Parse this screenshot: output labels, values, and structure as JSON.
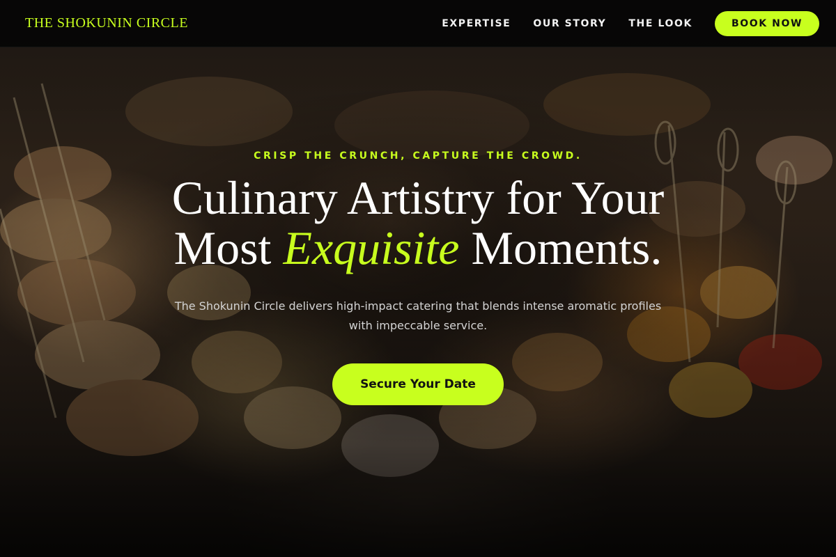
{
  "colors": {
    "accent": "#c8ff1e",
    "nav_background": "#050505",
    "heading_text": "#ffffff",
    "body_text": "#d4d4d4"
  },
  "nav": {
    "brand": "THE SHOKUNIN CIRCLE",
    "links": [
      {
        "label": "EXPERTISE"
      },
      {
        "label": "OUR STORY"
      },
      {
        "label": "THE LOOK"
      }
    ],
    "cta_label": "BOOK NOW"
  },
  "hero": {
    "background_image": "catering-canapes-table-photo",
    "eyebrow": "CRISP THE CRUNCH, CAPTURE THE CROWD.",
    "headline": {
      "line1": "Culinary Artistry for Your",
      "line2_before": "Most ",
      "line2_accent": "Exquisite",
      "line2_after": " Moments."
    },
    "subtext": "The Shokunin Circle delivers high-impact catering that blends intense aromatic profiles with impeccable service.",
    "cta_label": "Secure Your Date"
  }
}
